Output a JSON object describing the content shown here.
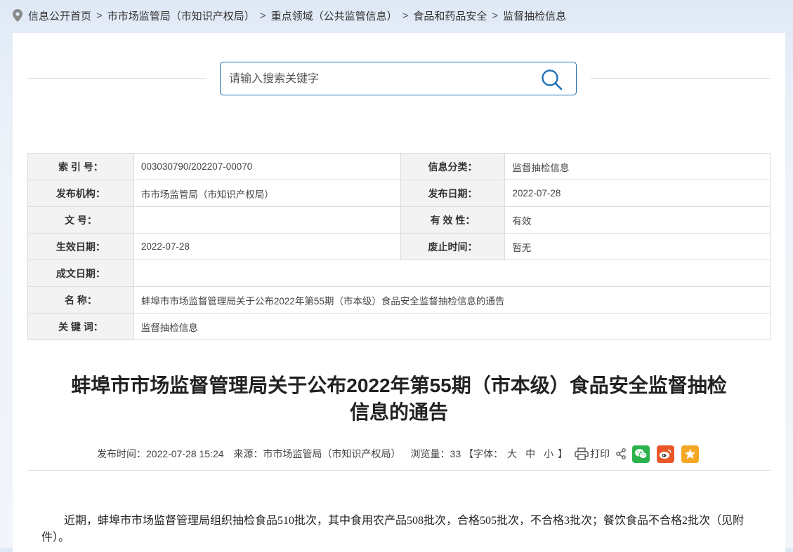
{
  "breadcrumb": {
    "items": [
      "信息公开首页",
      "市市场监管局（市知识产权局）",
      "重点领域（公共监管信息）",
      "食品和药品安全",
      "监督抽检信息"
    ],
    "separator": ">"
  },
  "search": {
    "placeholder": "请输入搜索关键字",
    "value": ""
  },
  "meta_table": {
    "index_label": "索  引  号：",
    "index_value": "003030790/202207-00070",
    "category_label": "信息分类：",
    "category_value": "监督抽检信息",
    "publisher_label": "发布机构：",
    "publisher_value": "市市场监管局（市知识产权局）",
    "pub_date_label": "发布日期：",
    "pub_date_value": "2022-07-28",
    "doc_no_label": "文    号：",
    "doc_no_value": "",
    "validity_label": "有  效  性：",
    "validity_value": "有效",
    "effective_label": "生效日期：",
    "effective_value": "2022-07-28",
    "expire_label": "废止时间：",
    "expire_value": "暂无",
    "created_label": "成文日期：",
    "created_value": "",
    "name_label": "名    称：",
    "name_value": "蚌埠市市场监督管理局关于公布2022年第55期（市本级）食品安全监督抽检信息的通告",
    "keywords_label": "关  键  词：",
    "keywords_value": "监督抽检信息"
  },
  "article": {
    "title_line1": "蚌埠市市场监督管理局关于公布2022年第55期（市本级）食品安全监督抽检",
    "title_line2": "信息的通告",
    "time_label": "发布时间：",
    "time_value": "2022-07-28 15:24",
    "source_label": "来源：",
    "source_value": "市市场监管局（市知识产权局）",
    "views_label": "浏览量：",
    "views_value": "33",
    "font_label": "【字体：",
    "font_large": "大",
    "font_medium": "中",
    "font_small": "小",
    "font_close": "】",
    "print_label": "打印",
    "body_paragraph": "近期，蚌埠市市场监督管理局组织抽检食品510批次，其中食用农产品508批次，合格505批次，不合格3批次；餐饮食品不合格2批次（见附件）。"
  },
  "colors": {
    "accent": "#1f6fb4",
    "wechat": "#2bb24c",
    "weibo": "#e8562a",
    "favorite": "#f5a623"
  },
  "icons": [
    "location-pin-icon",
    "search-icon",
    "printer-icon",
    "share-icon",
    "wechat-icon",
    "weibo-icon",
    "star-icon"
  ]
}
